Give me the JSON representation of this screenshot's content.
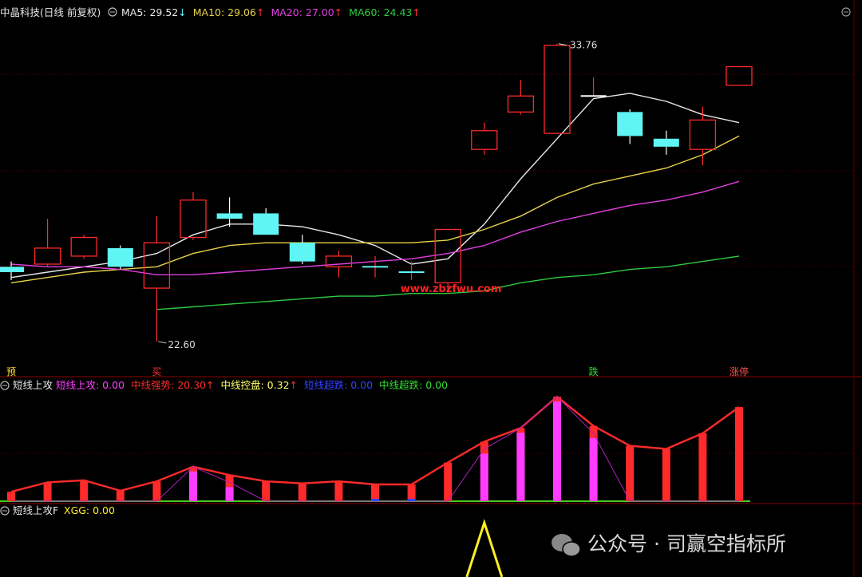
{
  "colors": {
    "background": "#000000",
    "grid": "#6b0000",
    "up": "#ff2a2a",
    "down": "#5ff5f5",
    "ma5": "#e8e8e8",
    "ma10": "#e6d24a",
    "ma20": "#e040e0",
    "ma60": "#2ecc40",
    "magenta_bar": "#ff3cff",
    "signal": "#ffee22"
  },
  "price_panel": {
    "title": "中晶科技(日线 前复权)",
    "legend": [
      {
        "label": "MA5: 29.52",
        "arrow": "↓",
        "color": "#e8e8e8"
      },
      {
        "label": "MA10: 29.06",
        "arrow": "↑",
        "color": "#e6d24a"
      },
      {
        "label": "MA20: 27.00",
        "arrow": "↑",
        "color": "#e040e0"
      },
      {
        "label": "MA60: 24.43",
        "arrow": "↑",
        "color": "#2ecc40"
      }
    ],
    "high_label": "33.76",
    "low_label": "22.60",
    "watermark": "www.zbzfwu.com",
    "signals": [
      {
        "index": 0,
        "text": "预",
        "color": "#ffdd33"
      },
      {
        "index": 4,
        "text": "买",
        "color": "#ff3030"
      },
      {
        "index": 16,
        "text": "跌",
        "color": "#33dd33"
      },
      {
        "index": 20,
        "text": "涨停",
        "color": "#ff5050"
      }
    ]
  },
  "indicator_panel": {
    "name": "短线上攻",
    "legend": [
      {
        "label": "短线上攻: 0.00",
        "color": "#ff40ff"
      },
      {
        "label": "中线强势: 20.30",
        "arrow": "↑",
        "color": "#ff2a2a"
      },
      {
        "label": "中线控盘: 0.32",
        "arrow": "↑",
        "color": "#ffff66"
      },
      {
        "label": "短线超跌: 0.00",
        "color": "#3344ff"
      },
      {
        "label": "中线超跌: 0.00",
        "color": "#33dd33"
      }
    ]
  },
  "signal_panel": {
    "name": "短线上攻F",
    "legend": [
      {
        "label": "XGG: 0.00",
        "color": "#ffee22"
      }
    ]
  },
  "footer": {
    "text": "公众号 · 司赢空指标所"
  },
  "chart_data": [
    {
      "type": "candlestick",
      "ylim": [
        22.0,
        34.5
      ],
      "candles": [
        {
          "open": 25.4,
          "close": 25.2,
          "high": 25.6,
          "low": 24.9
        },
        {
          "open": 25.5,
          "close": 26.1,
          "high": 27.2,
          "low": 25.4
        },
        {
          "open": 25.8,
          "close": 26.5,
          "high": 26.6,
          "low": 25.7
        },
        {
          "open": 26.1,
          "close": 25.4,
          "high": 26.2,
          "low": 25.3
        },
        {
          "open": 24.6,
          "close": 26.3,
          "high": 27.3,
          "low": 22.6
        },
        {
          "open": 26.5,
          "close": 27.9,
          "high": 28.2,
          "low": 26.4
        },
        {
          "open": 27.4,
          "close": 27.2,
          "high": 28.0,
          "low": 26.9
        },
        {
          "open": 27.4,
          "close": 26.6,
          "high": 27.6,
          "low": 26.6
        },
        {
          "open": 26.3,
          "close": 25.6,
          "high": 26.6,
          "low": 25.5
        },
        {
          "open": 25.4,
          "close": 25.8,
          "high": 26.0,
          "low": 25.0
        },
        {
          "open": 25.4,
          "close": 25.4,
          "high": 25.8,
          "low": 25.0
        },
        {
          "open": 25.2,
          "close": 25.2,
          "high": 25.6,
          "low": 24.9
        },
        {
          "open": 24.8,
          "close": 26.8,
          "high": 26.8,
          "low": 24.4
        },
        {
          "open": 29.8,
          "close": 30.5,
          "high": 30.8,
          "low": 29.6
        },
        {
          "open": 31.2,
          "close": 31.8,
          "high": 32.4,
          "low": 31.1
        },
        {
          "open": 30.4,
          "close": 33.7,
          "high": 33.76,
          "low": 30.4
        },
        {
          "open": 31.8,
          "close": 31.8,
          "high": 32.5,
          "low": 31.8
        },
        {
          "open": 31.2,
          "close": 30.3,
          "high": 31.3,
          "low": 30.0
        },
        {
          "open": 30.2,
          "close": 29.9,
          "high": 30.5,
          "low": 29.6
        },
        {
          "open": 29.8,
          "close": 30.9,
          "high": 31.4,
          "low": 29.2
        },
        {
          "open": 32.2,
          "close": 32.9,
          "high": 32.9,
          "low": 32.2
        }
      ],
      "series": [
        {
          "name": "MA5",
          "values": [
            25.0,
            25.2,
            25.4,
            25.6,
            25.9,
            26.6,
            27.0,
            27.0,
            26.9,
            26.6,
            26.2,
            25.5,
            25.7,
            27.0,
            28.7,
            30.2,
            31.7,
            31.9,
            31.6,
            31.1,
            30.8
          ]
        },
        {
          "name": "MA10",
          "values": [
            24.8,
            25.0,
            25.2,
            25.3,
            25.4,
            25.9,
            26.2,
            26.3,
            26.3,
            26.3,
            26.3,
            26.3,
            26.4,
            26.8,
            27.3,
            28.0,
            28.5,
            28.8,
            29.1,
            29.6,
            30.3
          ]
        },
        {
          "name": "MA20",
          "values": [
            25.5,
            25.4,
            25.4,
            25.3,
            25.1,
            25.1,
            25.2,
            25.3,
            25.4,
            25.5,
            25.6,
            25.7,
            25.9,
            26.2,
            26.7,
            27.1,
            27.4,
            27.7,
            27.9,
            28.2,
            28.6
          ]
        },
        {
          "name": "MA60",
          "values": [
            null,
            null,
            null,
            null,
            23.8,
            23.9,
            24.0,
            24.1,
            24.2,
            24.3,
            24.3,
            24.4,
            24.4,
            24.5,
            24.8,
            25.0,
            25.1,
            25.3,
            25.4,
            25.6,
            25.8
          ]
        }
      ]
    },
    {
      "type": "bar",
      "ylim": [
        0,
        100
      ],
      "series": [
        {
          "name": "中线强势",
          "values": [
            9,
            18,
            20,
            10,
            19,
            33,
            25,
            19,
            17,
            19,
            16,
            16,
            37,
            57,
            70,
            100,
            72,
            53,
            50,
            65,
            90
          ]
        },
        {
          "name": "短线上攻",
          "values": [
            0,
            0,
            0,
            0,
            0,
            33,
            18,
            0,
            0,
            0,
            0,
            0,
            0,
            50,
            70,
            100,
            65,
            0,
            0,
            0,
            0
          ]
        }
      ]
    },
    {
      "type": "line",
      "ylim": [
        0,
        1
      ],
      "series": [
        {
          "name": "XGG",
          "values": [
            0,
            0,
            0,
            0,
            0,
            0,
            0,
            0,
            0,
            0,
            0,
            0,
            0,
            1,
            0,
            0,
            0,
            0,
            0,
            0,
            0
          ]
        }
      ]
    }
  ]
}
